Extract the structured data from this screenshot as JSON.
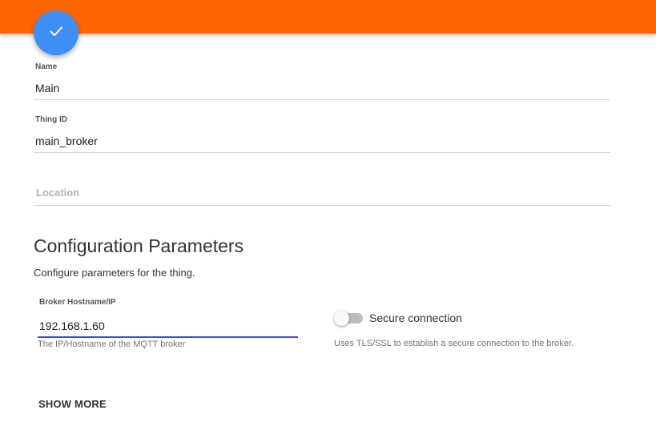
{
  "colors": {
    "topbar": "#ff6600",
    "fab": "#3f8ff5",
    "focus_underline": "#3f51b5"
  },
  "fab": {
    "icon": "check-icon"
  },
  "fields": {
    "name": {
      "label": "Name",
      "value": "Main"
    },
    "thing_id": {
      "label": "Thing ID",
      "value": "main_broker"
    },
    "location": {
      "placeholder": "Location",
      "value": ""
    }
  },
  "config": {
    "title": "Configuration Parameters",
    "description": "Configure parameters for the thing.",
    "broker": {
      "label": "Broker Hostname/IP",
      "value": "192.168.1.60",
      "hint": "The IP/Hostname of the MQTT broker"
    },
    "secure": {
      "label": "Secure connection",
      "checked": false,
      "hint": "Uses TLS/SSL to establish a secure connection to the broker."
    },
    "show_more_label": "SHOW MORE"
  }
}
